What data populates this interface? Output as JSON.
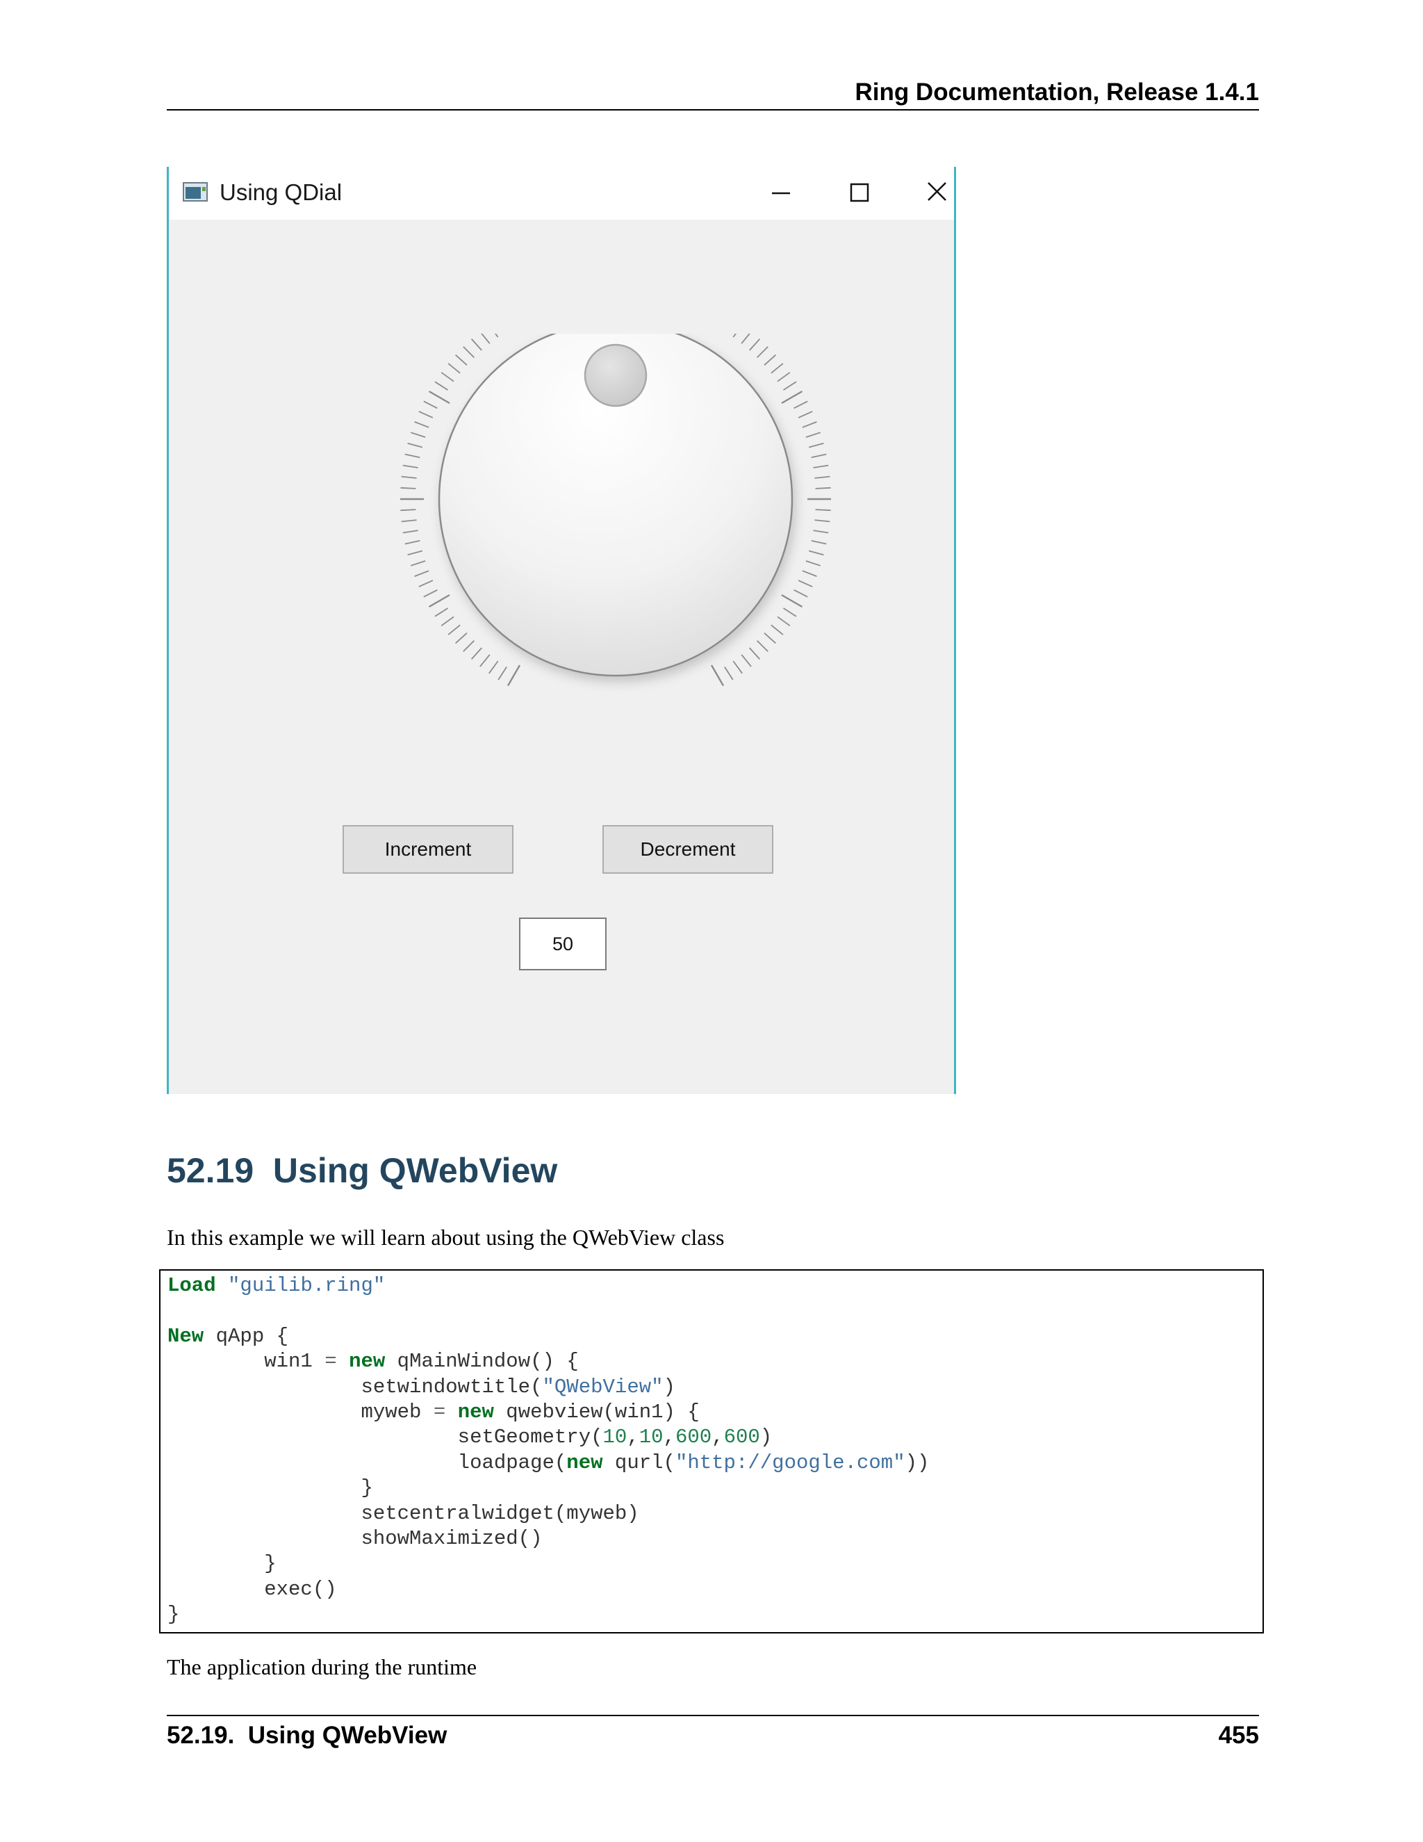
{
  "header": {
    "running_title": "Ring Documentation, Release 1.4.1"
  },
  "screenshot": {
    "window_title": "Using QDial",
    "increment_label": "Increment",
    "decrement_label": "Decrement",
    "value_text": "50",
    "accent_color": "#3fb5c0"
  },
  "section": {
    "number": "52.19",
    "title": "Using QWebView",
    "intro": "In this example we will learn about using the QWebView class",
    "after_code": "The application during the runtime"
  },
  "code": [
    [
      [
        "kw",
        "Load"
      ],
      [
        "t",
        " "
      ],
      [
        "str",
        "\"guilib.ring\""
      ]
    ],
    [],
    [
      [
        "kw",
        "New"
      ],
      [
        "t",
        " qApp {"
      ]
    ],
    [
      [
        "t",
        "        win1 "
      ],
      [
        "op",
        "="
      ],
      [
        "t",
        " "
      ],
      [
        "kw",
        "new"
      ],
      [
        "t",
        " qMainWindow() {"
      ]
    ],
    [
      [
        "t",
        "                setwindowtitle("
      ],
      [
        "str",
        "\"QWebView\""
      ],
      [
        "t",
        ")"
      ]
    ],
    [
      [
        "t",
        "                myweb "
      ],
      [
        "op",
        "="
      ],
      [
        "t",
        " "
      ],
      [
        "kw",
        "new"
      ],
      [
        "t",
        " qwebview(win1) {"
      ]
    ],
    [
      [
        "t",
        "                        setGeometry("
      ],
      [
        "num",
        "10"
      ],
      [
        "t",
        ","
      ],
      [
        "num",
        "10"
      ],
      [
        "t",
        ","
      ],
      [
        "num",
        "600"
      ],
      [
        "t",
        ","
      ],
      [
        "num",
        "600"
      ],
      [
        "t",
        ")"
      ]
    ],
    [
      [
        "t",
        "                        loadpage("
      ],
      [
        "kw",
        "new"
      ],
      [
        "t",
        " qurl("
      ],
      [
        "str",
        "\"http://google.com\""
      ],
      [
        "t",
        "))"
      ]
    ],
    [
      [
        "t",
        "                }"
      ]
    ],
    [
      [
        "t",
        "                setcentralwidget(myweb)"
      ]
    ],
    [
      [
        "t",
        "                showMaximized()"
      ]
    ],
    [
      [
        "t",
        "        }"
      ]
    ],
    [
      [
        "t",
        "        exec()"
      ]
    ],
    [
      [
        "t",
        "}"
      ]
    ]
  ],
  "footer": {
    "section_ref": "52.19.  Using QWebView",
    "page_number": "455"
  }
}
